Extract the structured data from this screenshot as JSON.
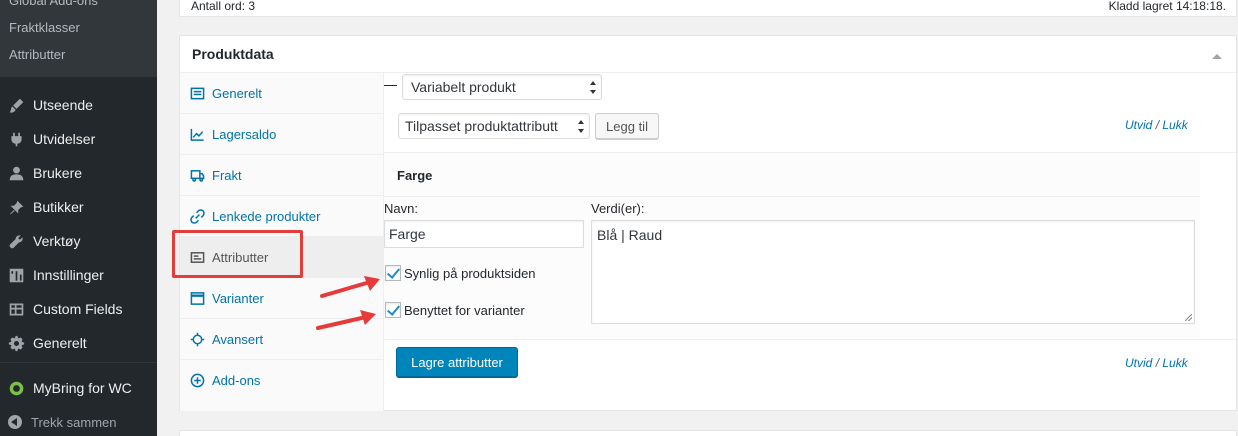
{
  "sidebar": {
    "submenu": [
      "Global Add-ons",
      "Fraktklasser",
      "Attributter"
    ],
    "items": [
      {
        "label": "Utseende",
        "icon": "paintbrush-icon"
      },
      {
        "label": "Utvidelser",
        "icon": "plugin-icon"
      },
      {
        "label": "Brukere",
        "icon": "users-icon"
      },
      {
        "label": "Butikker",
        "icon": "pin-icon"
      },
      {
        "label": "Verktøy",
        "icon": "wrench-icon"
      },
      {
        "label": "Innstillinger",
        "icon": "settings-icon"
      },
      {
        "label": "Custom Fields",
        "icon": "table-icon"
      },
      {
        "label": "Generelt",
        "icon": "gear-icon"
      },
      {
        "label": "MyBring for WC",
        "icon": "mybring-icon"
      }
    ],
    "collapse_label": "Trekk sammen"
  },
  "top_box": {
    "word_count": "Antall ord: 3",
    "draft_saved": "Kladd lagret 14:18:18."
  },
  "postbox": {
    "title": "Produktdata",
    "product_type": "Variabelt produkt",
    "tabs": [
      {
        "label": "Generelt",
        "icon": "settings-tab-icon"
      },
      {
        "label": "Lagersaldo",
        "icon": "inventory-icon"
      },
      {
        "label": "Frakt",
        "icon": "truck-icon"
      },
      {
        "label": "Lenkede produkter",
        "icon": "link-icon"
      },
      {
        "label": "Attributter",
        "icon": "attributes-icon"
      },
      {
        "label": "Varianter",
        "icon": "variations-icon"
      },
      {
        "label": "Avansert",
        "icon": "advanced-icon"
      },
      {
        "label": "Add-ons",
        "icon": "add-circle-icon"
      }
    ],
    "active_tab": "Attributter"
  },
  "attributes": {
    "select_value": "Tilpasset produktattributt",
    "add_button": "Legg til",
    "expand": "Utvid",
    "separator": "/",
    "close": "Lukk",
    "attribute_name_heading": "Farge",
    "name_label": "Navn:",
    "name_value": "Farge",
    "values_label": "Verdi(er):",
    "values_value": "Blå | Raud",
    "visible_label": "Synlig på produktsiden",
    "visible_checked": true,
    "variations_label": "Benyttet for varianter",
    "variations_checked": true,
    "save_button": "Lagre attributter"
  },
  "colors": {
    "admin_bar": "#23282d",
    "link": "#0073aa",
    "primary_button": "#0085ba",
    "annotation": "#e53b3b"
  }
}
